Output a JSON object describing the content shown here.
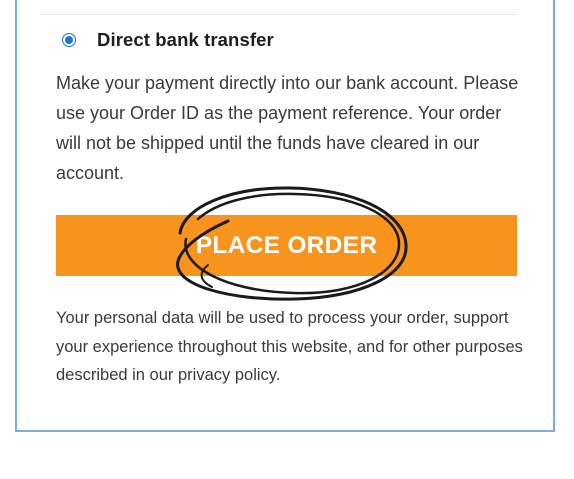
{
  "payment": {
    "method_label": "Direct bank transfer",
    "method_selected": true,
    "description": "Make your payment directly into our bank account. Please use your Order ID as the payment reference. Your order will not be shipped until the funds have cleared in our account."
  },
  "actions": {
    "place_order_label": "PLACE ORDER"
  },
  "privacy": {
    "text_before": "Your personal data will be used to process your order, support your experience throughout this website, and for other purposes described in our ",
    "link_label": "privacy policy",
    "text_after": "."
  },
  "colors": {
    "accent_orange": "#f7941d",
    "radio_blue": "#1a73e8",
    "card_border": "#7aaee0",
    "annotation_ink": "#1a1a1a"
  }
}
